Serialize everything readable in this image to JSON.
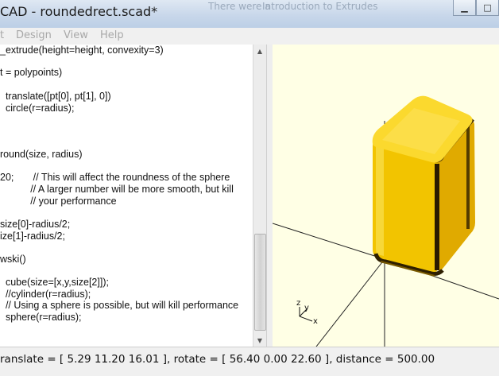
{
  "window": {
    "title": "CAD - roundedrect.scad*",
    "ghost_text_1": "There were a",
    "ghost_text_2": "Introduction to Extrudes"
  },
  "menu": [
    "t",
    "Design",
    "View",
    "Help"
  ],
  "editor": {
    "lines": [
      "_extrude(height=height, convexity=3)",
      "",
      "t = polypoints)",
      "",
      "  translate([pt[0], pt[1], 0])",
      "  circle(r=radius);",
      "",
      "",
      "",
      "round(size, radius)",
      "",
      "20;       // This will affect the roundness of the sphere",
      "           // A larger number will be more smooth, but kill",
      "           // your performance",
      "",
      "size[0]-radius/2;",
      "ize[1]-radius/2;",
      "",
      "wski()",
      "",
      "  cube(size=[x,y,size[2]]);",
      "  //cylinder(r=radius);",
      "  // Using a sphere is possible, but will kill performance",
      "  sphere(r=radius);"
    ]
  },
  "viewport": {
    "background": "#ffffe5",
    "object_color": "#f5c800",
    "axis_labels": {
      "x": "x",
      "y": "y",
      "z": "z"
    }
  },
  "statusbar": {
    "text": "ranslate = [ 5.29 11.20 16.01 ], rotate = [ 56.40 0.00 22.60 ], distance = 500.00"
  }
}
